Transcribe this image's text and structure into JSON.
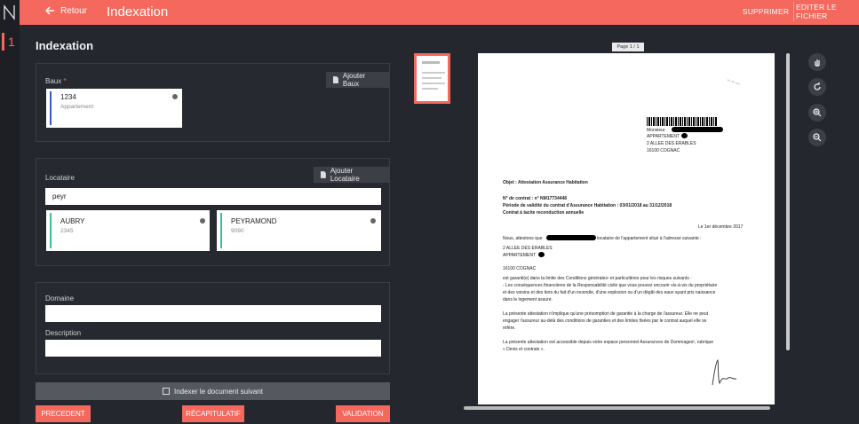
{
  "rail": {
    "logo": "N",
    "active_item": "1"
  },
  "header": {
    "back_label": "Retour",
    "title": "Indexation",
    "delete_label": "SUPPRIMER",
    "edit_label": "EDITER LE FICHIER",
    "accent": "#f4685d"
  },
  "main": {
    "title": "Indexation",
    "baux": {
      "label": "Baux",
      "required_mark": "*",
      "add_label": "Ajouter Baux",
      "card": {
        "title": "1234",
        "subtitle": "Appartement",
        "bar_color": "#3a56c8"
      }
    },
    "locataire": {
      "label": "Locataire",
      "add_label": "Ajouter Locataire",
      "search_value": "peyr",
      "results": [
        {
          "name": "AUBRY",
          "code": "2345",
          "bar_color": "#3fbf92"
        },
        {
          "name": "PEYRAMOND",
          "code": "9090",
          "bar_color": "#3fbf92"
        }
      ]
    },
    "domaine": {
      "label": "Domaine",
      "value": ""
    },
    "description": {
      "label": "Description",
      "value": ""
    },
    "index_next_label": "Indexer le document suivant",
    "buttons": {
      "prev": "PRECEDENT",
      "recap": "RÉCAPITULATIF",
      "validate": "VALIDATION"
    }
  },
  "viewer": {
    "page_indicator": "Page 1 / 1",
    "document": {
      "recipient": [
        "Monsieur",
        "APPARTEMENT",
        "2 ALLEE DES ERABLES",
        "16100 COGNAC"
      ],
      "object": "Objet : Attestation Assurance Habitation",
      "contract_no": "N° de contrat : n° NM17734448",
      "period": "Période de validité du contrat d'Assurance Habitation : 03/01/2018 au 31/12/2018",
      "renewal": "Contrat à tacite reconduction annuelle",
      "date": "Le 1er décembre 2017",
      "attest_start": "Nous, attestons que",
      "attest_end": "locataire de l'appartement situé à l'adresse suivante :",
      "addr1": "2 ALLEE DES ERABLES",
      "addr2": "APPARTEMENT",
      "city": "16100 COGNAC",
      "p1": "est garanti(e) dans la limite des Conditions générales¹ et particulières pour les risques suivants :",
      "p2": "- Les conséquences financières de la Responsabilité civile que vous pouvez encourir vis-à-vis du propriétaire",
      "p3": "et des voisins et des tiers du fait d'un incendie, d'une explosion ou d'un dégât des eaux ayant pris naissance",
      "p4": "dans le logement assuré.",
      "p5": "La présente attestation n'implique qu'une présomption de garantie à la charge de l'assureur. Elle ne peut",
      "p6": "engager l'assureur au-delà des conditions de garanties et des limites fixées par le contrat auquel elle se",
      "p7": "réfère.",
      "p8": "La présente attestation est accessible depuis votre espace personnel Assurances de Dommages², rubrique",
      "p9": "« Devis et contrats »."
    },
    "tools": [
      "hand-icon",
      "rotate-icon",
      "zoom-in-icon",
      "zoom-out-icon"
    ]
  }
}
